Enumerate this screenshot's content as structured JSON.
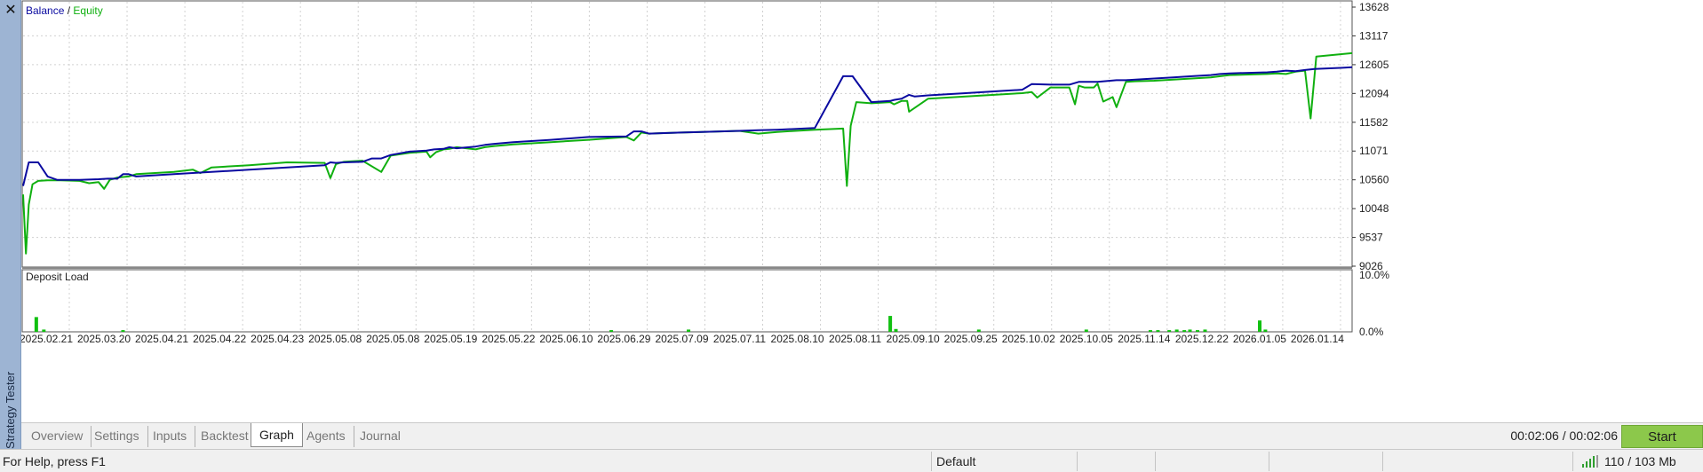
{
  "window": {
    "side_title": "Strategy Tester",
    "close_glyph": "✕"
  },
  "chart": {
    "legend": {
      "balance": "Balance",
      "separator": " / ",
      "equity": "Equity"
    },
    "colors": {
      "balance": "#0a0aa0",
      "equity": "#10b010",
      "deposit": "#10c010",
      "grid": "#d0d0d0"
    },
    "deposit_title": "Deposit Load"
  },
  "chart_data": [
    {
      "type": "line",
      "title": "",
      "ylim": [
        9026,
        13628
      ],
      "y_ticks": [
        13628,
        13117,
        12605,
        12094,
        11582,
        11071,
        10560,
        10048,
        9537,
        9026
      ],
      "x_ticks": [
        "2025.02.21",
        "2025.03.20",
        "2025.04.21",
        "2025.04.22",
        "2025.04.23",
        "2025.05.08",
        "2025.05.08",
        "2025.05.19",
        "2025.05.22",
        "2025.06.10",
        "2025.06.29",
        "2025.07.09",
        "2025.07.11",
        "2025.08.10",
        "2025.08.11",
        "2025.09.10",
        "2025.09.25",
        "2025.10.02",
        "2025.10.05",
        "2025.11.14",
        "2025.12.22",
        "2026.01.05",
        "2026.01.14"
      ],
      "grid": true,
      "legend_position": "top-left",
      "series": [
        {
          "name": "Balance",
          "x": [
            0,
            0.3,
            0.8,
            1.3,
            1.8,
            2.1,
            2.5,
            3,
            4,
            4.5,
            5,
            5.3,
            5.6,
            6,
            8,
            10,
            12,
            14,
            16,
            16.3,
            16.6,
            17,
            18,
            18.5,
            19,
            19.5,
            20.5,
            21.4,
            21.8,
            22.3,
            22.6,
            23,
            24,
            24.5,
            25,
            26,
            28,
            30,
            32,
            32.4,
            32.8,
            33.2,
            34,
            36,
            38,
            39,
            40,
            42,
            43.5,
            44,
            45,
            46,
            46.2,
            46.6,
            47,
            47.3,
            48,
            50,
            52,
            53,
            53.5,
            54.5,
            55.5,
            56,
            57,
            58,
            58.5,
            59,
            60,
            61,
            62,
            63,
            63.5,
            64,
            66,
            66.5,
            67,
            67.5,
            68,
            68.5,
            70,
            70.5
          ],
          "y": [
            10450,
            10870,
            10870,
            10620,
            10560,
            10560,
            10560,
            10560,
            10570,
            10580,
            10580,
            10660,
            10660,
            10620,
            10660,
            10700,
            10740,
            10780,
            10820,
            10870,
            10860,
            10870,
            10880,
            10940,
            10940,
            11000,
            11060,
            11080,
            11100,
            11110,
            11140,
            11120,
            11150,
            11180,
            11200,
            11230,
            11270,
            11320,
            11330,
            11420,
            11420,
            11380,
            11390,
            11410,
            11430,
            11440,
            11450,
            11480,
            12400,
            12400,
            11940,
            11960,
            11980,
            12000,
            12070,
            12040,
            12060,
            12100,
            12140,
            12160,
            12260,
            12250,
            12250,
            12300,
            12300,
            12330,
            12330,
            12340,
            12360,
            12380,
            12400,
            12420,
            12440,
            12450,
            12470,
            12480,
            12500,
            12490,
            12510,
            12530,
            12550,
            12560
          ]
        },
        {
          "name": "Equity",
          "x": [
            0,
            0.15,
            0.3,
            0.5,
            0.8,
            1.3,
            2,
            3,
            3.5,
            4,
            4.3,
            4.6,
            5,
            5.3,
            5.6,
            6,
            8,
            9,
            9.4,
            10,
            12,
            14,
            16,
            16.3,
            16.6,
            17,
            18,
            19,
            19.5,
            20.5,
            21.4,
            21.6,
            21.9,
            22.3,
            22.6,
            23,
            24,
            24.5,
            25,
            26,
            28,
            30,
            32,
            32.4,
            32.8,
            33.2,
            34,
            36,
            38,
            39,
            40,
            42,
            43.5,
            43.7,
            43.9,
            44.2,
            45,
            46,
            46.2,
            46.6,
            46.9,
            47,
            48,
            50,
            52,
            53,
            53.5,
            53.8,
            54.5,
            55.5,
            55.8,
            56,
            56.3,
            56.8,
            57,
            57.3,
            57.8,
            58,
            58.5,
            59,
            60,
            61,
            62,
            63,
            63.5,
            64,
            66,
            66.5,
            67,
            67.5,
            68,
            68.3,
            68.6,
            70.5
          ],
          "y": [
            10300,
            9250,
            10120,
            10480,
            10540,
            10550,
            10550,
            10540,
            10500,
            10520,
            10400,
            10560,
            10600,
            10610,
            10620,
            10660,
            10700,
            10740,
            10680,
            10780,
            10820,
            10870,
            10860,
            10590,
            10840,
            10880,
            10900,
            10700,
            10990,
            11040,
            11060,
            10960,
            11050,
            11100,
            11110,
            11140,
            11100,
            11140,
            11160,
            11190,
            11230,
            11270,
            11320,
            11260,
            11400,
            11380,
            11390,
            11410,
            11430,
            11380,
            11410,
            11450,
            11470,
            10450,
            11520,
            11940,
            11920,
            11940,
            11900,
            11960,
            11960,
            11770,
            12000,
            12040,
            12080,
            12100,
            12120,
            12020,
            12200,
            12200,
            11900,
            12230,
            12200,
            12200,
            12270,
            11950,
            12030,
            11850,
            12300,
            12310,
            12320,
            12340,
            12360,
            12380,
            12400,
            12420,
            12440,
            12450,
            12440,
            12480,
            12500,
            11650,
            12750,
            12810
          ]
        }
      ]
    },
    {
      "type": "bar",
      "title": "Deposit Load",
      "ylim": [
        0,
        10
      ],
      "y_ticks": [
        "10.0%",
        "0.0%"
      ],
      "series": [
        {
          "name": "Deposit Load",
          "x": [
            0.7,
            1.1,
            5.3,
            31.2,
            35.3,
            46.0,
            46.3,
            50.7,
            56.4,
            59.8,
            60.2,
            60.8,
            61.2,
            61.6,
            61.9,
            62.3,
            62.7,
            65.6,
            65.9
          ],
          "values": [
            2.6,
            0.4,
            0.3,
            0.3,
            0.4,
            2.8,
            0.5,
            0.4,
            0.4,
            0.3,
            0.3,
            0.3,
            0.4,
            0.3,
            0.4,
            0.3,
            0.4,
            2.0,
            0.4
          ]
        }
      ]
    }
  ],
  "tabs": [
    {
      "label": "Overview",
      "active": false
    },
    {
      "label": "Settings",
      "active": false
    },
    {
      "label": "Inputs",
      "active": false
    },
    {
      "label": "Backtest",
      "active": false
    },
    {
      "label": "Graph",
      "active": true
    },
    {
      "label": "Agents",
      "active": false
    },
    {
      "label": "Journal",
      "active": false
    }
  ],
  "timer": "00:02:06 / 00:02:06",
  "start_label": "Start",
  "status": {
    "help": "For Help, press F1",
    "profile": "Default",
    "memory": "110 / 103 Mb",
    "signal_icon": "signal-bars-icon"
  }
}
